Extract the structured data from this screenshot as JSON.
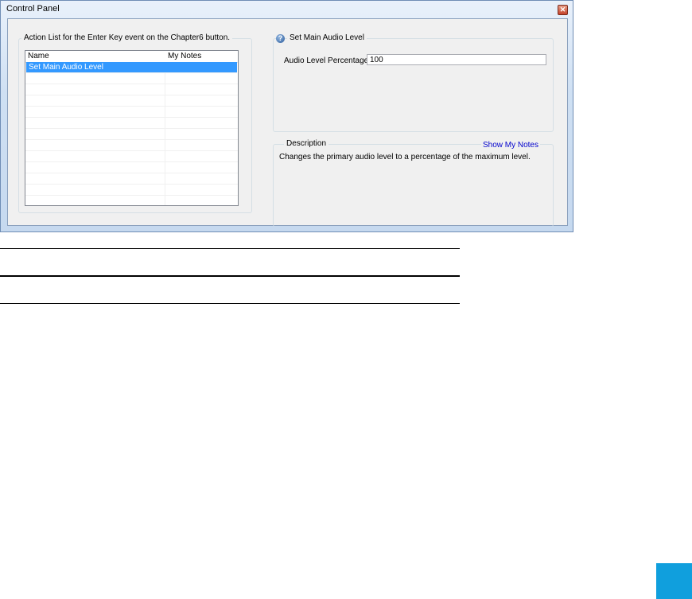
{
  "window": {
    "title": "Control Panel",
    "close_glyph": "✕"
  },
  "action_list": {
    "group_title": "Action List for the Enter Key event on the Chapter6 button.",
    "columns": [
      "Name",
      "My Notes"
    ],
    "rows": [
      {
        "name": "Set Main Audio Level",
        "notes": "",
        "selected": true
      }
    ]
  },
  "action_panel": {
    "title": "Set Main Audio Level",
    "icon": "help-icon",
    "audio_level_label": "Audio Level Percentage",
    "audio_level_value": "100"
  },
  "description": {
    "title": "Description",
    "show_notes_link": "Show My Notes",
    "text": "Changes the primary audio level to a percentage of the maximum level."
  },
  "colors": {
    "selection": "#3399ff",
    "link": "#0000cc",
    "corner_accent": "#109fdd"
  }
}
